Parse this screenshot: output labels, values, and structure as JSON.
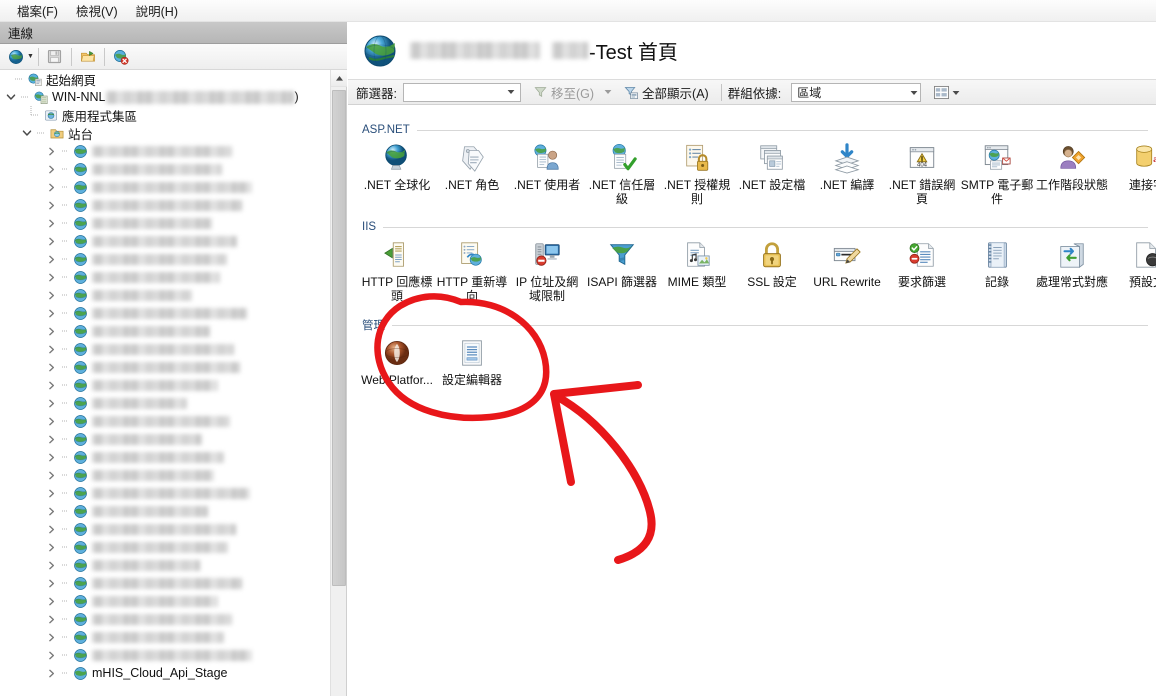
{
  "window": {
    "menu": [
      {
        "label": "檔案(F)",
        "name": "menu-file"
      },
      {
        "label": "檢視(V)",
        "name": "menu-view"
      },
      {
        "label": "說明(H)",
        "name": "menu-help"
      }
    ]
  },
  "sidebar": {
    "header_title": "連線",
    "toolbar": [
      {
        "name": "connect-globe-icon",
        "title": "連線"
      },
      {
        "name": "save-icon",
        "title": "儲存"
      },
      {
        "name": "open-folder-icon",
        "title": "開啟"
      },
      {
        "name": "disconnect-icon",
        "title": "中斷連線"
      }
    ],
    "tree": {
      "start_page": "起始網頁",
      "server_name_prefix": "WIN-NNL",
      "server_name_suffix": ")",
      "app_pools": "應用程式集區",
      "sites": "站台",
      "site_count": 29,
      "last_visible_partial": "mHIS_Cloud_Api_Stage"
    },
    "scrollbar": {
      "position": "top",
      "thumb_pct": 79
    }
  },
  "content": {
    "page_title_suffix": "-Test 首頁",
    "filter": {
      "label": "篩選器:",
      "value": "",
      "placeholder": "",
      "go_label": "移至(G)",
      "show_all_label": "全部顯示(A)",
      "group_by_label": "群組依據:",
      "group_by_value": "區域",
      "view_mode": "詳細資料檢視"
    },
    "sections": [
      {
        "title": "ASP.NET",
        "name": "section-aspnet",
        "items": [
          {
            "label": ".NET 全球化",
            "icon": "globe-icon"
          },
          {
            "label": ".NET 角色",
            "icon": "tags-icon"
          },
          {
            "label": ".NET 使用者",
            "icon": "user-doc-icon"
          },
          {
            "label": ".NET 信任層級",
            "icon": "globe-check-icon"
          },
          {
            "label": ".NET 授權規則",
            "icon": "lock-list-icon"
          },
          {
            "label": ".NET 設定檔",
            "icon": "windows-stack-icon"
          },
          {
            "label": ".NET 編譯",
            "icon": "download-stack-icon"
          },
          {
            "label": ".NET 錯誤網頁",
            "icon": "error-404-icon"
          },
          {
            "label": "SMTP 電子郵件",
            "icon": "smtp-mail-icon"
          },
          {
            "label": "工作階段狀態",
            "icon": "session-state-icon"
          },
          {
            "label": "連接字",
            "icon": "database-icon"
          }
        ]
      },
      {
        "title": "IIS",
        "name": "section-iis",
        "items": [
          {
            "label": "HTTP 回應標頭",
            "icon": "http-headers-icon"
          },
          {
            "label": "HTTP 重新導向",
            "icon": "http-redirect-icon"
          },
          {
            "label": "IP 位址及網域限制",
            "icon": "ip-restrict-icon"
          },
          {
            "label": "ISAPI 篩選器",
            "icon": "isapi-filter-icon"
          },
          {
            "label": "MIME 類型",
            "icon": "mime-types-icon"
          },
          {
            "label": "SSL 設定",
            "icon": "padlock-icon"
          },
          {
            "label": "URL Rewrite",
            "icon": "url-rewrite-icon"
          },
          {
            "label": "要求篩選",
            "icon": "request-filter-icon"
          },
          {
            "label": "記錄",
            "icon": "logging-icon"
          },
          {
            "label": "處理常式對應",
            "icon": "handler-mappings-icon"
          },
          {
            "label": "預設文",
            "icon": "default-document-icon"
          }
        ]
      },
      {
        "title": "管理",
        "name": "section-management",
        "items": [
          {
            "label": "Web Platfor...",
            "icon": "web-platform-installer-icon"
          },
          {
            "label": "設定編輯器",
            "icon": "configuration-editor-icon"
          }
        ]
      }
    ]
  },
  "annotation": {
    "color": "#e8171a",
    "shapes": [
      "circle-highlight",
      "arrow-pointer"
    ],
    "target": "設定編輯器"
  }
}
